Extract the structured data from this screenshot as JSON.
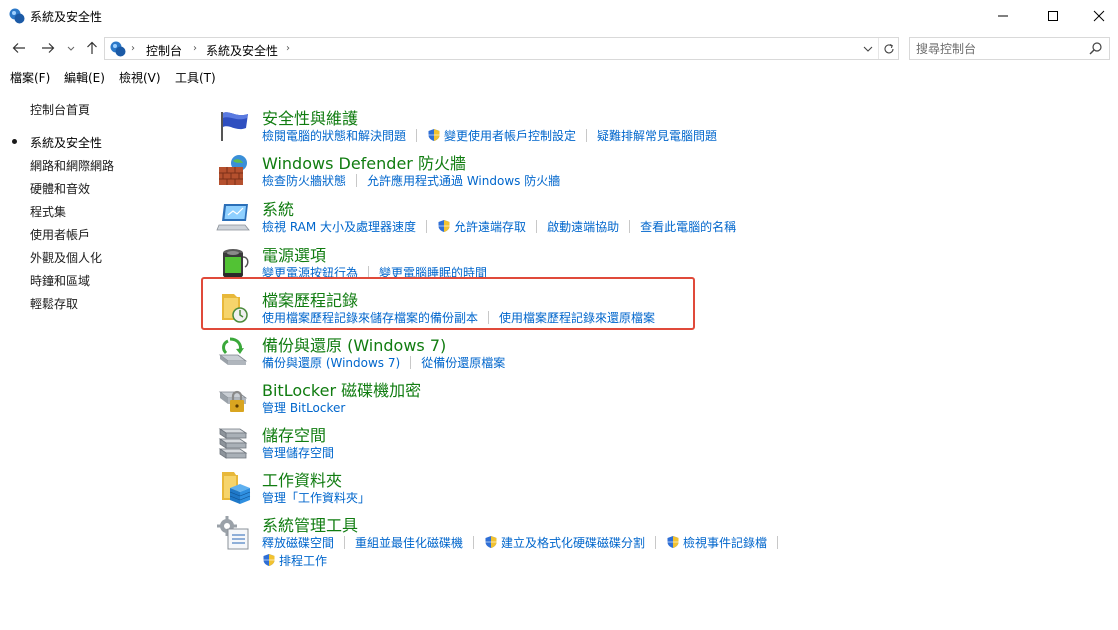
{
  "window": {
    "title": "系統及安全性"
  },
  "address": {
    "breadcrumbs": [
      "控制台",
      "系統及安全性"
    ],
    "search_placeholder": "搜尋控制台"
  },
  "menu": [
    "檔案(F)",
    "編輯(E)",
    "檢視(V)",
    "工具(T)"
  ],
  "left_nav": {
    "home": "控制台首頁",
    "items": [
      "系統及安全性",
      "網路和網際網路",
      "硬體和音效",
      "程式集",
      "使用者帳戶",
      "外觀及個人化",
      "時鐘和區域",
      "輕鬆存取"
    ],
    "current": "系統及安全性"
  },
  "categories": [
    {
      "title": "安全性與維護",
      "icon": "flag-icon",
      "links": [
        {
          "text": "檢閱電腦的狀態和解決問題",
          "shield": false
        },
        {
          "text": "變更使用者帳戶控制設定",
          "shield": true
        },
        {
          "text": "疑難排解常見電腦問題",
          "shield": false
        }
      ]
    },
    {
      "title": "Windows Defender 防火牆",
      "icon": "firewall-icon",
      "links": [
        {
          "text": "檢查防火牆狀態",
          "shield": false
        },
        {
          "text": "允許應用程式通過 Windows 防火牆",
          "shield": false
        }
      ]
    },
    {
      "title": "系統",
      "icon": "computer-icon",
      "links": [
        {
          "text": "檢視 RAM 大小及處理器速度",
          "shield": false
        },
        {
          "text": "允許遠端存取",
          "shield": true
        },
        {
          "text": "啟動遠端協助",
          "shield": false
        },
        {
          "text": "查看此電腦的名稱",
          "shield": false
        }
      ]
    },
    {
      "title": "電源選項",
      "icon": "battery-icon",
      "links": [
        {
          "text": "變更電源按鈕行為",
          "shield": false
        },
        {
          "text": "變更電腦睡眠的時間",
          "shield": false
        }
      ]
    },
    {
      "title": "檔案歷程記錄",
      "icon": "file-history-icon",
      "links": [
        {
          "text": "使用檔案歷程記錄來儲存檔案的備份副本",
          "shield": false
        },
        {
          "text": "使用檔案歷程記錄來還原檔案",
          "shield": false
        }
      ]
    },
    {
      "title": "備份與還原 (Windows 7)",
      "icon": "backup-icon",
      "links": [
        {
          "text": "備份與還原 (Windows 7)",
          "shield": false
        },
        {
          "text": "從備份還原檔案",
          "shield": false
        }
      ]
    },
    {
      "title": "BitLocker 磁碟機加密",
      "icon": "bitlocker-icon",
      "links": [
        {
          "text": "管理 BitLocker",
          "shield": false
        }
      ]
    },
    {
      "title": "儲存空間",
      "icon": "storage-icon",
      "links": [
        {
          "text": "管理儲存空間",
          "shield": false
        }
      ]
    },
    {
      "title": "工作資料夾",
      "icon": "work-folders-icon",
      "links": [
        {
          "text": "管理「工作資料夾」",
          "shield": false
        }
      ]
    },
    {
      "title": "系統管理工具",
      "icon": "admin-tools-icon",
      "links": [
        {
          "text": "釋放磁碟空間",
          "shield": false
        },
        {
          "text": "重組並最佳化磁碟機",
          "shield": false
        },
        {
          "text": "建立及格式化硬碟磁碟分割",
          "shield": true
        },
        {
          "text": "檢視事件記錄檔",
          "shield": true
        }
      ],
      "links_row2": [
        {
          "text": "排程工作",
          "shield": true
        }
      ]
    }
  ]
}
